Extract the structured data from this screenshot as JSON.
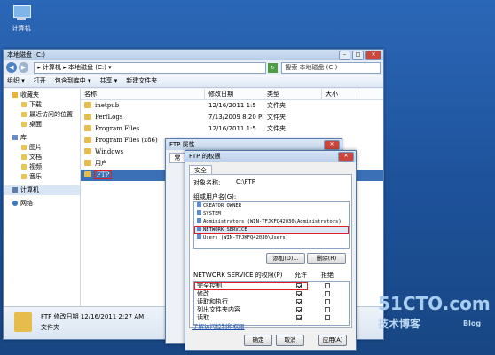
{
  "desktop": {
    "icon_label": "计算机"
  },
  "explorer": {
    "title": "本地磁盘 (C:)",
    "address": "▸ 计算机 ▸ 本地磁盘 (C:) ▾",
    "search_placeholder": "搜索 本地磁盘 (C:)",
    "toolbar": [
      "组织 ▾",
      "打开",
      "包含到库中 ▾",
      "共享 ▾",
      "新建文件夹"
    ],
    "nav": [
      {
        "label": "收藏夹",
        "icon": "star-icon",
        "level": 0
      },
      {
        "label": "下载",
        "icon": "folder-icon",
        "level": 1
      },
      {
        "label": "最近访问的位置",
        "icon": "folder-icon",
        "level": 1
      },
      {
        "label": "桌面",
        "icon": "folder-icon",
        "level": 1
      },
      {
        "label": "库",
        "icon": "library-icon",
        "level": 0
      },
      {
        "label": "图片",
        "icon": "folder-icon",
        "level": 1
      },
      {
        "label": "文档",
        "icon": "folder-icon",
        "level": 1
      },
      {
        "label": "视频",
        "icon": "folder-icon",
        "level": 1
      },
      {
        "label": "音乐",
        "icon": "folder-icon",
        "level": 1
      },
      {
        "label": "计算机",
        "icon": "computer-icon",
        "level": 0
      },
      {
        "label": "网络",
        "icon": "network-icon",
        "level": 0
      }
    ],
    "columns": [
      "名称",
      "修改日期",
      "类型",
      "大小"
    ],
    "files": [
      {
        "name": "inetpub",
        "date": "12/16/2011 1:5",
        "type": "文件夹"
      },
      {
        "name": "PerfLogs",
        "date": "7/13/2009 8:20 PM",
        "type": "文件夹"
      },
      {
        "name": "Program Files",
        "date": "12/16/2011 1:5",
        "type": "文件夹"
      },
      {
        "name": "Program Files (x86)",
        "date": "",
        "type": ""
      },
      {
        "name": "Windows",
        "date": "",
        "type": ""
      },
      {
        "name": "用户",
        "date": "",
        "type": ""
      },
      {
        "name": "FTP",
        "date": "",
        "type": ""
      }
    ],
    "details": {
      "line1": "FTP    修改日期  12/16/2011 2:27 AM",
      "line2": "文件夹"
    }
  },
  "props": {
    "title": "FTP 属性",
    "tab": "常"
  },
  "perm": {
    "title": "FTP 的权限",
    "tab": "安全",
    "object_label": "对象名称:",
    "object_value": "C:\\FTP",
    "group_label": "组或用户名(G):",
    "users": [
      "CREATOR OWNER",
      "SYSTEM",
      "Administrators (WIN-TFJKFQ42030\\Administrators)",
      "NETWORK SERVICE",
      "Users (WIN-TFJKFQ42030\\Users)"
    ],
    "add_label": "添加(D)...",
    "remove_label": "删除(R)",
    "perm_label": "NETWORK SERVICE 的权限(P)",
    "allow_label": "允许",
    "deny_label": "拒绝",
    "permissions": [
      {
        "name": "完全控制",
        "allow": true,
        "deny": false
      },
      {
        "name": "修改",
        "allow": true,
        "deny": false
      },
      {
        "name": "读取和执行",
        "allow": true,
        "deny": false
      },
      {
        "name": "列出文件夹内容",
        "allow": true,
        "deny": false
      },
      {
        "name": "读取",
        "allow": true,
        "deny": false
      }
    ],
    "link": "了解访问控制和权限",
    "ok": "确定",
    "cancel": "取消",
    "apply": "应用(A)"
  },
  "watermark": {
    "line1": "51CTO.com",
    "line2": "技术博客",
    "line3": "Blog"
  }
}
